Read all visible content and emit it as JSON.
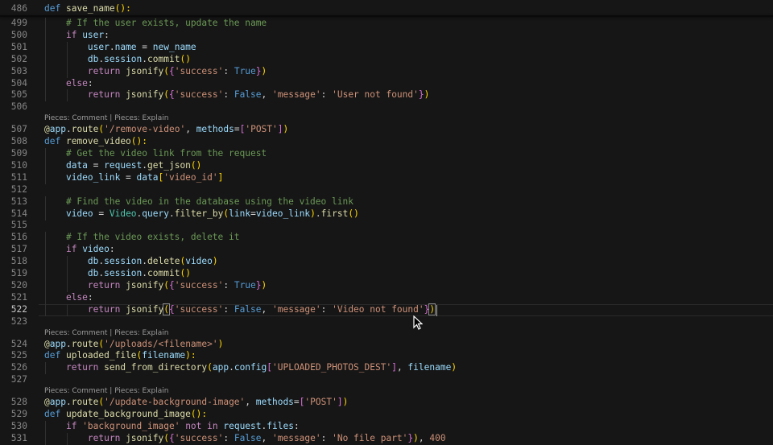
{
  "editor": {
    "sticky_line": {
      "number": "486",
      "tokens": [
        {
          "t": "def",
          "c": "def"
        },
        {
          "t": " ",
          "c": "pn"
        },
        {
          "t": "save_name",
          "c": "fn"
        },
        {
          "t": "():",
          "c": "p1"
        }
      ]
    },
    "lines": [
      {
        "type": "code",
        "number": "499",
        "tokens": [
          {
            "t": "    "
          },
          {
            "t": "# If the user exists, update the name",
            "c": "cm"
          }
        ]
      },
      {
        "type": "code",
        "number": "500",
        "tokens": [
          {
            "t": "    "
          },
          {
            "t": "if",
            "c": "kw"
          },
          {
            "t": " "
          },
          {
            "t": "user",
            "c": "var"
          },
          {
            "t": ":"
          }
        ]
      },
      {
        "type": "code",
        "number": "501",
        "tokens": [
          {
            "t": "        "
          },
          {
            "t": "user",
            "c": "var"
          },
          {
            "t": "."
          },
          {
            "t": "name",
            "c": "var"
          },
          {
            "t": " = "
          },
          {
            "t": "new_name",
            "c": "var"
          }
        ]
      },
      {
        "type": "code",
        "number": "502",
        "tokens": [
          {
            "t": "        "
          },
          {
            "t": "db",
            "c": "var"
          },
          {
            "t": "."
          },
          {
            "t": "session",
            "c": "var"
          },
          {
            "t": "."
          },
          {
            "t": "commit",
            "c": "fn"
          },
          {
            "t": "()",
            "c": "p1"
          }
        ]
      },
      {
        "type": "code",
        "number": "503",
        "tokens": [
          {
            "t": "        "
          },
          {
            "t": "return",
            "c": "kw"
          },
          {
            "t": " "
          },
          {
            "t": "jsonify",
            "c": "fn"
          },
          {
            "t": "(",
            "c": "p1"
          },
          {
            "t": "{",
            "c": "p2"
          },
          {
            "t": "'success'",
            "c": "str"
          },
          {
            "t": ": "
          },
          {
            "t": "True",
            "c": "cst"
          },
          {
            "t": "}",
            "c": "p2"
          },
          {
            "t": ")",
            "c": "p1"
          }
        ]
      },
      {
        "type": "code",
        "number": "504",
        "tokens": [
          {
            "t": "    "
          },
          {
            "t": "else",
            "c": "kw"
          },
          {
            "t": ":"
          }
        ]
      },
      {
        "type": "code",
        "number": "505",
        "tokens": [
          {
            "t": "        "
          },
          {
            "t": "return",
            "c": "kw"
          },
          {
            "t": " "
          },
          {
            "t": "jsonify",
            "c": "fn"
          },
          {
            "t": "(",
            "c": "p1"
          },
          {
            "t": "{",
            "c": "p2"
          },
          {
            "t": "'success'",
            "c": "str"
          },
          {
            "t": ": "
          },
          {
            "t": "False",
            "c": "cst"
          },
          {
            "t": ", "
          },
          {
            "t": "'message'",
            "c": "str"
          },
          {
            "t": ": "
          },
          {
            "t": "'User not found'",
            "c": "str"
          },
          {
            "t": "}",
            "c": "p2"
          },
          {
            "t": ")",
            "c": "p1"
          }
        ]
      },
      {
        "type": "code",
        "number": "506",
        "tokens": []
      },
      {
        "type": "lens",
        "comment": "Pieces: Comment",
        "explain": "Pieces: Explain"
      },
      {
        "type": "code",
        "number": "507",
        "tokens": [
          {
            "t": "@",
            "c": "fn"
          },
          {
            "t": "app",
            "c": "var"
          },
          {
            "t": "."
          },
          {
            "t": "route",
            "c": "fn"
          },
          {
            "t": "(",
            "c": "p1"
          },
          {
            "t": "'/remove-video'",
            "c": "str"
          },
          {
            "t": ", "
          },
          {
            "t": "methods",
            "c": "var"
          },
          {
            "t": "="
          },
          {
            "t": "[",
            "c": "p2"
          },
          {
            "t": "'POST'",
            "c": "str"
          },
          {
            "t": "]",
            "c": "p2"
          },
          {
            "t": ")",
            "c": "p1"
          }
        ]
      },
      {
        "type": "code",
        "number": "508",
        "tokens": [
          {
            "t": "def",
            "c": "def"
          },
          {
            "t": " "
          },
          {
            "t": "remove_video",
            "c": "fn"
          },
          {
            "t": "():",
            "c": "p1"
          }
        ]
      },
      {
        "type": "code",
        "number": "509",
        "tokens": [
          {
            "t": "    "
          },
          {
            "t": "# Get the video link from the request",
            "c": "cm"
          }
        ]
      },
      {
        "type": "code",
        "number": "510",
        "tokens": [
          {
            "t": "    "
          },
          {
            "t": "data",
            "c": "var"
          },
          {
            "t": " = "
          },
          {
            "t": "request",
            "c": "var"
          },
          {
            "t": "."
          },
          {
            "t": "get_json",
            "c": "fn"
          },
          {
            "t": "()",
            "c": "p1"
          }
        ]
      },
      {
        "type": "code",
        "number": "511",
        "tokens": [
          {
            "t": "    "
          },
          {
            "t": "video_link",
            "c": "var"
          },
          {
            "t": " = "
          },
          {
            "t": "data",
            "c": "var"
          },
          {
            "t": "[",
            "c": "p1"
          },
          {
            "t": "'video_id'",
            "c": "str"
          },
          {
            "t": "]",
            "c": "p1"
          }
        ]
      },
      {
        "type": "code",
        "number": "512",
        "tokens": []
      },
      {
        "type": "code",
        "number": "513",
        "tokens": [
          {
            "t": "    "
          },
          {
            "t": "# Find the video in the database using the video link",
            "c": "cm"
          }
        ]
      },
      {
        "type": "code",
        "number": "514",
        "tokens": [
          {
            "t": "    "
          },
          {
            "t": "video",
            "c": "var"
          },
          {
            "t": " = "
          },
          {
            "t": "Video",
            "c": "cls"
          },
          {
            "t": "."
          },
          {
            "t": "query",
            "c": "var"
          },
          {
            "t": "."
          },
          {
            "t": "filter_by",
            "c": "fn"
          },
          {
            "t": "(",
            "c": "p1"
          },
          {
            "t": "link",
            "c": "var"
          },
          {
            "t": "="
          },
          {
            "t": "video_link",
            "c": "var"
          },
          {
            "t": ")",
            "c": "p1"
          },
          {
            "t": "."
          },
          {
            "t": "first",
            "c": "fn"
          },
          {
            "t": "()",
            "c": "p1"
          }
        ]
      },
      {
        "type": "code",
        "number": "515",
        "tokens": []
      },
      {
        "type": "code",
        "number": "516",
        "tokens": [
          {
            "t": "    "
          },
          {
            "t": "# If the video exists, delete it",
            "c": "cm"
          }
        ]
      },
      {
        "type": "code",
        "number": "517",
        "tokens": [
          {
            "t": "    "
          },
          {
            "t": "if",
            "c": "kw"
          },
          {
            "t": " "
          },
          {
            "t": "video",
            "c": "var"
          },
          {
            "t": ":"
          }
        ]
      },
      {
        "type": "code",
        "number": "518",
        "tokens": [
          {
            "t": "        "
          },
          {
            "t": "db",
            "c": "var"
          },
          {
            "t": "."
          },
          {
            "t": "session",
            "c": "var"
          },
          {
            "t": "."
          },
          {
            "t": "delete",
            "c": "fn"
          },
          {
            "t": "(",
            "c": "p1"
          },
          {
            "t": "video",
            "c": "var"
          },
          {
            "t": ")",
            "c": "p1"
          }
        ]
      },
      {
        "type": "code",
        "number": "519",
        "tokens": [
          {
            "t": "        "
          },
          {
            "t": "db",
            "c": "var"
          },
          {
            "t": "."
          },
          {
            "t": "session",
            "c": "var"
          },
          {
            "t": "."
          },
          {
            "t": "commit",
            "c": "fn"
          },
          {
            "t": "()",
            "c": "p1"
          }
        ]
      },
      {
        "type": "code",
        "number": "520",
        "tokens": [
          {
            "t": "        "
          },
          {
            "t": "return",
            "c": "kw"
          },
          {
            "t": " "
          },
          {
            "t": "jsonify",
            "c": "fn"
          },
          {
            "t": "(",
            "c": "p1"
          },
          {
            "t": "{",
            "c": "p2"
          },
          {
            "t": "'success'",
            "c": "str"
          },
          {
            "t": ": "
          },
          {
            "t": "True",
            "c": "cst"
          },
          {
            "t": "}",
            "c": "p2"
          },
          {
            "t": ")",
            "c": "p1"
          }
        ]
      },
      {
        "type": "code",
        "number": "521",
        "tokens": [
          {
            "t": "    "
          },
          {
            "t": "else",
            "c": "kw"
          },
          {
            "t": ":"
          }
        ]
      },
      {
        "type": "code",
        "number": "522",
        "active": true,
        "tokens": [
          {
            "t": "        "
          },
          {
            "t": "return",
            "c": "kw"
          },
          {
            "t": " "
          },
          {
            "t": "jsonify",
            "c": "fn"
          },
          {
            "t": "(",
            "c": "p1 bm"
          },
          {
            "t": "{",
            "c": "p2"
          },
          {
            "t": "'success'",
            "c": "str"
          },
          {
            "t": ": "
          },
          {
            "t": "False",
            "c": "cst"
          },
          {
            "t": ", "
          },
          {
            "t": "'message'",
            "c": "str"
          },
          {
            "t": ": "
          },
          {
            "t": "'Video not found'",
            "c": "str"
          },
          {
            "t": "}",
            "c": "p2"
          },
          {
            "t": ")",
            "c": "p1 bm"
          }
        ]
      },
      {
        "type": "code",
        "number": "523",
        "tokens": []
      },
      {
        "type": "lens",
        "comment": "Pieces: Comment",
        "explain": "Pieces: Explain"
      },
      {
        "type": "code",
        "number": "524",
        "tokens": [
          {
            "t": "@",
            "c": "fn"
          },
          {
            "t": "app",
            "c": "var"
          },
          {
            "t": "."
          },
          {
            "t": "route",
            "c": "fn"
          },
          {
            "t": "(",
            "c": "p1"
          },
          {
            "t": "'/uploads/<filename>'",
            "c": "str"
          },
          {
            "t": ")",
            "c": "p1"
          }
        ]
      },
      {
        "type": "code",
        "number": "525",
        "tokens": [
          {
            "t": "def",
            "c": "def"
          },
          {
            "t": " "
          },
          {
            "t": "uploaded_file",
            "c": "fn"
          },
          {
            "t": "(",
            "c": "p1"
          },
          {
            "t": "filename",
            "c": "var"
          },
          {
            "t": "):",
            "c": "p1"
          }
        ]
      },
      {
        "type": "code",
        "number": "526",
        "tokens": [
          {
            "t": "    "
          },
          {
            "t": "return",
            "c": "kw"
          },
          {
            "t": " "
          },
          {
            "t": "send_from_directory",
            "c": "fn"
          },
          {
            "t": "(",
            "c": "p1"
          },
          {
            "t": "app",
            "c": "var"
          },
          {
            "t": "."
          },
          {
            "t": "config",
            "c": "var"
          },
          {
            "t": "[",
            "c": "p2"
          },
          {
            "t": "'UPLOADED_PHOTOS_DEST'",
            "c": "str"
          },
          {
            "t": "]",
            "c": "p2"
          },
          {
            "t": ", "
          },
          {
            "t": "filename",
            "c": "var"
          },
          {
            "t": ")",
            "c": "p1"
          }
        ]
      },
      {
        "type": "code",
        "number": "527",
        "tokens": []
      },
      {
        "type": "lens",
        "comment": "Pieces: Comment",
        "explain": "Pieces: Explain"
      },
      {
        "type": "code",
        "number": "528",
        "tokens": [
          {
            "t": "@",
            "c": "fn"
          },
          {
            "t": "app",
            "c": "var"
          },
          {
            "t": "."
          },
          {
            "t": "route",
            "c": "fn"
          },
          {
            "t": "(",
            "c": "p1"
          },
          {
            "t": "'/update-background-image'",
            "c": "str"
          },
          {
            "t": ", "
          },
          {
            "t": "methods",
            "c": "var"
          },
          {
            "t": "="
          },
          {
            "t": "[",
            "c": "p2"
          },
          {
            "t": "'POST'",
            "c": "str"
          },
          {
            "t": "]",
            "c": "p2"
          },
          {
            "t": ")",
            "c": "p1"
          }
        ]
      },
      {
        "type": "code",
        "number": "529",
        "tokens": [
          {
            "t": "def",
            "c": "def"
          },
          {
            "t": " "
          },
          {
            "t": "update_background_image",
            "c": "fn"
          },
          {
            "t": "():",
            "c": "p1"
          }
        ]
      },
      {
        "type": "code",
        "number": "530",
        "tokens": [
          {
            "t": "    "
          },
          {
            "t": "if",
            "c": "kw"
          },
          {
            "t": " "
          },
          {
            "t": "'background_image'",
            "c": "str"
          },
          {
            "t": " "
          },
          {
            "t": "not in",
            "c": "kw"
          },
          {
            "t": " "
          },
          {
            "t": "request",
            "c": "var"
          },
          {
            "t": "."
          },
          {
            "t": "files",
            "c": "var"
          },
          {
            "t": ":"
          }
        ]
      },
      {
        "type": "code",
        "number": "531",
        "tokens": [
          {
            "t": "        "
          },
          {
            "t": "return",
            "c": "kw"
          },
          {
            "t": " "
          },
          {
            "t": "jsonify",
            "c": "fn"
          },
          {
            "t": "(",
            "c": "p1"
          },
          {
            "t": "{",
            "c": "p2"
          },
          {
            "t": "'success'",
            "c": "str"
          },
          {
            "t": ": "
          },
          {
            "t": "False",
            "c": "cst"
          },
          {
            "t": ", "
          },
          {
            "t": "'message'",
            "c": "str"
          },
          {
            "t": ": "
          },
          {
            "t": "'No file part'",
            "c": "str"
          },
          {
            "t": "}",
            "c": "p2"
          },
          {
            "t": ")",
            "c": "p1"
          },
          {
            "t": ", "
          },
          {
            "t": "400",
            "c": "str"
          }
        ]
      }
    ]
  }
}
